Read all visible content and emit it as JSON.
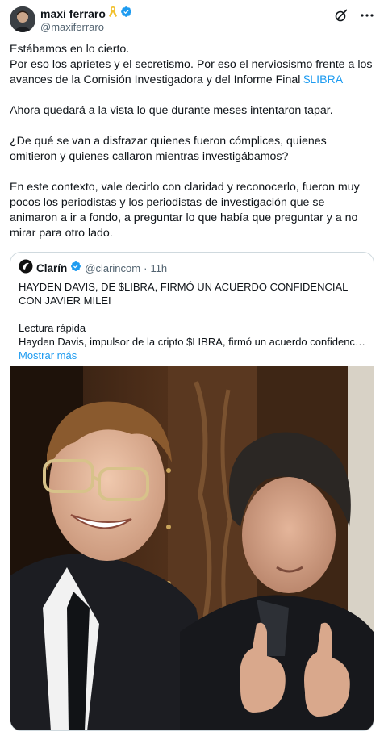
{
  "author": {
    "display_name": "maxi ferraro",
    "handle": "@maxiferraro"
  },
  "tweet": {
    "para1_line1": "Estábamos en lo cierto.",
    "para1_line2": "Por eso los aprietes y el secretismo. Por eso el nerviosismo frente a los avances de la Comisión Investigadora y del Informe Final ",
    "hashtag": "$LIBRA",
    "para2": "Ahora quedará a la vista lo que durante meses intentaron tapar.",
    "para3": "¿De qué se van a disfrazar quienes fueron cómplices, quienes omitieron y quienes callaron mientras investigábamos?",
    "para4": "En este contexto, vale decirlo con claridad y reconocerlo, fueron muy pocos los periodistas y los periodistas de investigación que se animaron a ir a fondo, a preguntar lo que había que preguntar y a no mirar para otro lado."
  },
  "quote": {
    "name": "Clarín",
    "handle": "@clarincom",
    "separator": "·",
    "time": "11h",
    "headline": "HAYDEN DAVIS, DE $LIBRA, FIRMÓ UN ACUERDO CONFIDENCIAL CON JAVIER MILEI",
    "label": "Lectura rápida",
    "summary": "Hayden Davis, impulsor de la cripto $LIBRA, firmó un acuerdo confidencial c...",
    "show_more": "Mostrar más"
  },
  "icons": {
    "verified": "verified-badge-icon",
    "ribbon": "yellow-ribbon-icon",
    "grok": "grok-icon",
    "more": "more-options-icon"
  },
  "colors": {
    "link": "#1d9bf0",
    "secondary_text": "#536471",
    "verified": "#1d9bf0",
    "ribbon": "#f2c12e"
  }
}
